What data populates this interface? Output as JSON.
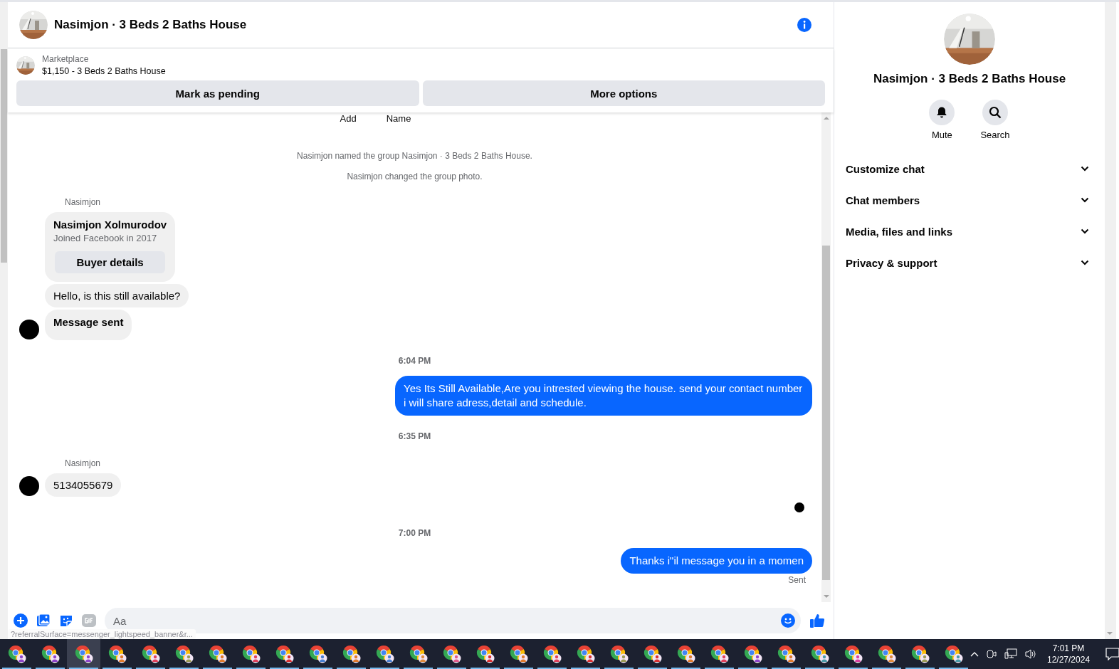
{
  "header": {
    "title": "Nasimjon · 3 Beds 2 Baths House"
  },
  "listing": {
    "source": "Marketplace",
    "title": "$1,150 - 3 Beds 2 Baths House",
    "buttons": [
      "Mark as pending",
      "More options"
    ]
  },
  "cut_labels": [
    "Add",
    "Name"
  ],
  "messages": [
    {
      "kind": "system",
      "text": "Nasimjon named the group Nasimjon · 3 Beds 2 Baths House."
    },
    {
      "kind": "system",
      "text": "Nasimjon changed the group photo."
    },
    {
      "kind": "sender",
      "text": "Nasimjon"
    },
    {
      "kind": "card",
      "name": "Nasimjon Xolmurodov",
      "detail": "Joined Facebook in 2017",
      "button": "Buyer details"
    },
    {
      "kind": "incoming",
      "text": "Hello, is this still available?",
      "avatar": false,
      "bold": false
    },
    {
      "kind": "incoming",
      "text": "Message sent",
      "avatar": true,
      "bold": true
    },
    {
      "kind": "time",
      "text": "6:04 PM"
    },
    {
      "kind": "outgoing",
      "text": "Yes Its Still Available,Are you intrested viewing the house. send your contact number i will share adress,detail and schedule."
    },
    {
      "kind": "time",
      "text": "6:35 PM"
    },
    {
      "kind": "sender",
      "text": "Nasimjon"
    },
    {
      "kind": "incoming",
      "text": "5134055679",
      "avatar": true,
      "bold": false
    },
    {
      "kind": "seen"
    },
    {
      "kind": "time",
      "text": "7:00 PM"
    },
    {
      "kind": "outgoing",
      "text": "Thanks i\"il message you in a momen"
    },
    {
      "kind": "status",
      "text": "Sent"
    }
  ],
  "composer": {
    "placeholder": "Aa"
  },
  "status_url": "?referralSurface=messenger_lightspeed_banner&r...",
  "details": {
    "title": "Nasimjon · 3 Beds 2 Baths House",
    "actions": [
      {
        "kind": "mute",
        "label": "Mute"
      },
      {
        "kind": "search",
        "label": "Search"
      }
    ],
    "sections": [
      {
        "label": "Customize chat",
        "expanded": false
      },
      {
        "label": "Chat members",
        "expanded": false
      },
      {
        "label": "Media, files and links",
        "expanded": false
      },
      {
        "label": "Privacy & support",
        "expanded": false
      }
    ]
  },
  "taskbar": {
    "apps": [
      {
        "color": "#8e44c9",
        "selected": false
      },
      {
        "color": "#8e44c9",
        "selected": false
      },
      {
        "color": "#8e44c9",
        "selected": true
      },
      {
        "color": "#e07a2c",
        "selected": false
      },
      {
        "color": "#e0405a",
        "selected": false
      },
      {
        "color": "#9a9a55",
        "selected": false
      },
      {
        "color": "#e07a2c",
        "selected": false
      },
      {
        "color": "#e0405a",
        "selected": false
      },
      {
        "color": "#d83030",
        "selected": false
      },
      {
        "color": "#4a7fd0",
        "selected": false
      },
      {
        "color": "#e07a2c",
        "selected": false
      },
      {
        "color": "#4a7fd0",
        "selected": false
      },
      {
        "color": "#e08a3c",
        "selected": false
      },
      {
        "color": "#e05a8a",
        "selected": false
      },
      {
        "color": "#d83030",
        "selected": false
      },
      {
        "color": "#e07a2c",
        "selected": false
      },
      {
        "color": "#e0405a",
        "selected": false
      },
      {
        "color": "#d83030",
        "selected": false
      },
      {
        "color": "#9a9a55",
        "selected": false
      },
      {
        "color": "#d83030",
        "selected": false
      },
      {
        "color": "#e07a2c",
        "selected": false
      },
      {
        "color": "#e0405a",
        "selected": false
      },
      {
        "color": "#8e44c9",
        "selected": false
      },
      {
        "color": "#e07a2c",
        "selected": false
      },
      {
        "color": "#4a9aa8",
        "selected": false
      },
      {
        "color": "#d840a0",
        "selected": false
      },
      {
        "color": "#e08a3c",
        "selected": false
      },
      {
        "color": "#9a9a55",
        "selected": false
      },
      {
        "color": "#4a9aa8",
        "selected": false
      }
    ],
    "time": "7:01 PM",
    "date": "12/27/2024"
  }
}
